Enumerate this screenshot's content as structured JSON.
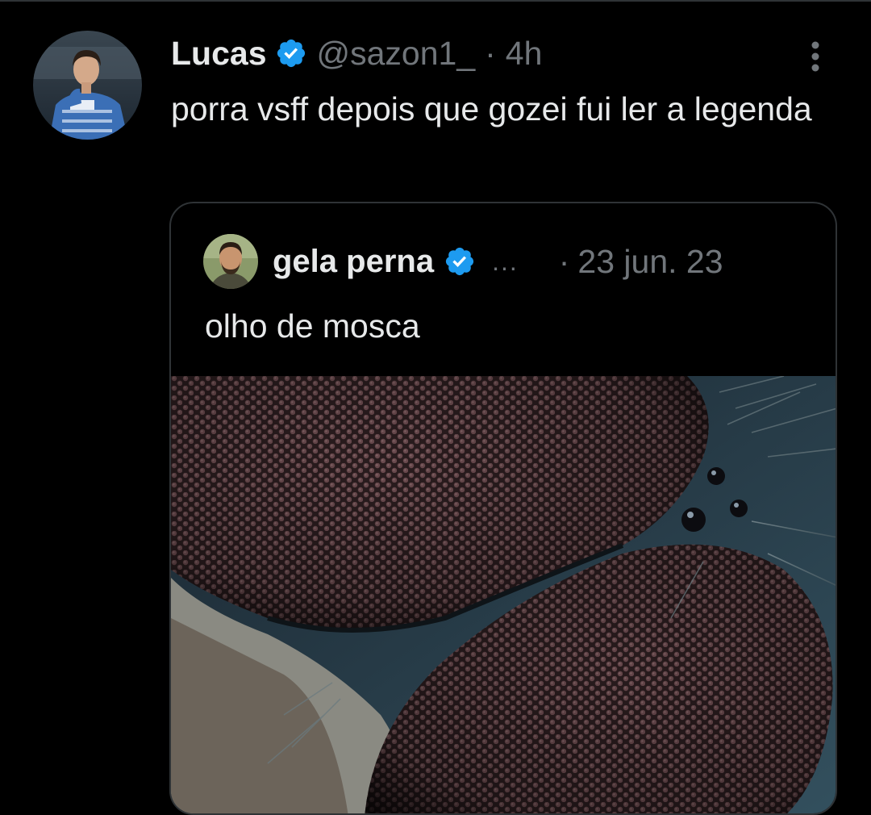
{
  "tweet": {
    "author": {
      "display_name": "Lucas",
      "handle": "@sazon1_",
      "verified": true,
      "avatar_icon": "profile-photo-player-blue-jersey"
    },
    "separator": "·",
    "time": "4h",
    "text": "porra vsff depois que gozei fui ler a legenda",
    "more_icon": "vertical-ellipsis-icon"
  },
  "quoted_tweet": {
    "author": {
      "display_name": "gela perna",
      "verified": true,
      "avatar_icon": "profile-photo-bearded-man"
    },
    "ellipsis": "...",
    "separator": "·",
    "date": "23 jun. 23",
    "text": "olho de mosca",
    "media_icon": "fly-compound-eye-macro-photo"
  },
  "colors": {
    "background": "#000000",
    "text_primary": "#e7e9ea",
    "text_secondary": "#71767b",
    "border": "#2f3336",
    "verified_badge": "#1d9bf0"
  }
}
